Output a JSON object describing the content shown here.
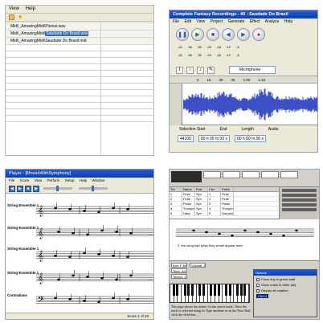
{
  "top_left": {
    "menu": [
      "View",
      "Help"
    ],
    "list_rows": [
      "Midi\\_AmazingMidi\\Pianist.wav",
      "Midi\\_AmazingMidi\\Saudade Do Brasil.wav",
      "Midi\\_AmazingMidi\\Saudade Do Brasil.mid"
    ],
    "selected_text": "Saudade Do Brasil.wav"
  },
  "top_right": {
    "title": "Complete Fantasy Recordings - 40 - Saudade Do Brasil",
    "menu": [
      "File",
      "Edit",
      "View",
      "Project",
      "Generate",
      "Effect",
      "Analyze",
      "Help"
    ],
    "meter_ticks": [
      "-42",
      "-36",
      "-30",
      "-24",
      "-18",
      "-12",
      "-6"
    ],
    "device": "Microphone",
    "ruler": [
      "0",
      "15",
      "30",
      "45",
      "1:00",
      "1:15"
    ],
    "selection_start_label": "Selection Start",
    "end_label": "End",
    "length_label": "Length",
    "audio_label": "Audio",
    "time_value": "00 h 00 m 00 s",
    "rate_label": "44100"
  },
  "bottom_left": {
    "title": "Player - [Mozart40thSymphony]",
    "menu": [
      "File",
      "Score",
      "View",
      "Perform",
      "Setup",
      "Help",
      "Window",
      "Help"
    ],
    "labels": [
      "String Ensemble 1",
      "String Ensemble 1",
      "String Ensemble 1",
      "String Ensemble 1",
      "Contrabass"
    ],
    "status": "Score 1 of 40"
  },
  "bottom_right": {
    "table_headers": [
      "Trk",
      "Name",
      "Port",
      "Chn",
      "Patch"
    ],
    "table_rows": [
      [
        "1",
        "Flute",
        "Syn",
        "1",
        "Flute"
      ],
      [
        "2",
        "Flute",
        "Syn",
        "2",
        "Flute"
      ],
      [
        "3",
        "Piano",
        "Syn",
        "3",
        "Piano"
      ],
      [
        "4",
        "Trumpet",
        "Syn",
        "4",
        "Trumpet"
      ],
      [
        "5",
        "Harp",
        "Syn",
        "5",
        "Harpsichord"
      ]
    ],
    "lyric": "2. the song had lyrics they would appear here",
    "props": [
      "Key: F Major",
      "Time: 4/4",
      "Tempo: 120",
      "Volume: 100"
    ],
    "caption": "The page shows the music for the active track. Once the track is selected using its Type attribute as in the Note Roll, click the field that ...",
    "dialog_title": "Options",
    "dialog_rows": [
      "Force tiny to grand staff",
      "Show notes to other (all)",
      "Display all notation"
    ],
    "dialog_select": "C5/C4"
  }
}
